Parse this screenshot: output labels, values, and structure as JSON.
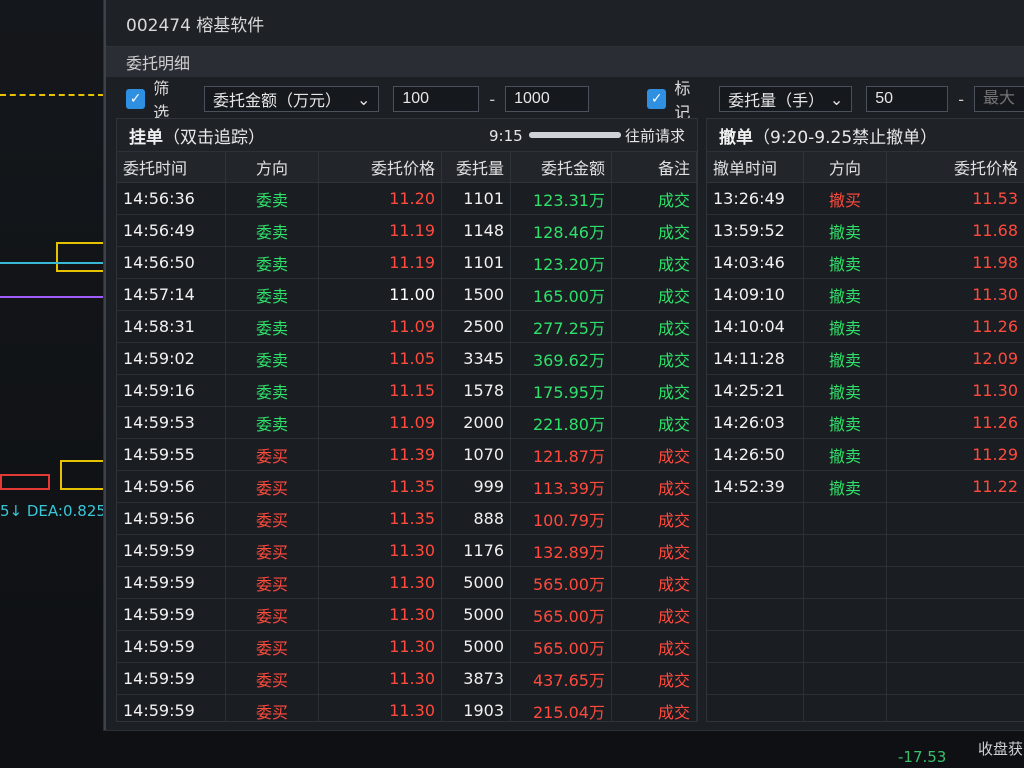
{
  "window": {
    "title": "002474 榕基软件",
    "subtitle": "委托明细"
  },
  "filter": {
    "checkbox1_label": "筛选",
    "amount_select": "委托金额（万元）",
    "amount_min": "100",
    "amount_max": "1000",
    "checkbox2_label": "标记",
    "qty_select": "委托量（手）",
    "qty_min": "50",
    "qty_max_placeholder": "最大"
  },
  "left_panel": {
    "title": "挂单",
    "title_hint": "（双击追踪）",
    "time": "9:15",
    "progress_pct": 100,
    "request_btn": "往前请求",
    "columns": [
      "委托时间",
      "方向",
      "委托价格",
      "委托量",
      "委托金额",
      "备注"
    ],
    "rows": [
      {
        "time": "14:56:36",
        "dir": "委卖",
        "side": "sell",
        "price": "11.20",
        "price_color": "red",
        "vol": "1101",
        "amt": "123.31万",
        "remark": "成交"
      },
      {
        "time": "14:56:49",
        "dir": "委卖",
        "side": "sell",
        "price": "11.19",
        "price_color": "red",
        "vol": "1148",
        "amt": "128.46万",
        "remark": "成交"
      },
      {
        "time": "14:56:50",
        "dir": "委卖",
        "side": "sell",
        "price": "11.19",
        "price_color": "red",
        "vol": "1101",
        "amt": "123.20万",
        "remark": "成交"
      },
      {
        "time": "14:57:14",
        "dir": "委卖",
        "side": "sell",
        "price": "11.00",
        "price_color": "white",
        "vol": "1500",
        "amt": "165.00万",
        "remark": "成交"
      },
      {
        "time": "14:58:31",
        "dir": "委卖",
        "side": "sell",
        "price": "11.09",
        "price_color": "red",
        "vol": "2500",
        "amt": "277.25万",
        "remark": "成交"
      },
      {
        "time": "14:59:02",
        "dir": "委卖",
        "side": "sell",
        "price": "11.05",
        "price_color": "red",
        "vol": "3345",
        "amt": "369.62万",
        "remark": "成交"
      },
      {
        "time": "14:59:16",
        "dir": "委卖",
        "side": "sell",
        "price": "11.15",
        "price_color": "red",
        "vol": "1578",
        "amt": "175.95万",
        "remark": "成交"
      },
      {
        "time": "14:59:53",
        "dir": "委卖",
        "side": "sell",
        "price": "11.09",
        "price_color": "red",
        "vol": "2000",
        "amt": "221.80万",
        "remark": "成交"
      },
      {
        "time": "14:59:55",
        "dir": "委买",
        "side": "buy",
        "price": "11.39",
        "price_color": "red",
        "vol": "1070",
        "amt": "121.87万",
        "remark": "成交"
      },
      {
        "time": "14:59:56",
        "dir": "委买",
        "side": "buy",
        "price": "11.35",
        "price_color": "red",
        "vol": "999",
        "amt": "113.39万",
        "remark": "成交"
      },
      {
        "time": "14:59:56",
        "dir": "委买",
        "side": "buy",
        "price": "11.35",
        "price_color": "red",
        "vol": "888",
        "amt": "100.79万",
        "remark": "成交"
      },
      {
        "time": "14:59:59",
        "dir": "委买",
        "side": "buy",
        "price": "11.30",
        "price_color": "red",
        "vol": "1176",
        "amt": "132.89万",
        "remark": "成交"
      },
      {
        "time": "14:59:59",
        "dir": "委买",
        "side": "buy",
        "price": "11.30",
        "price_color": "red",
        "vol": "5000",
        "amt": "565.00万",
        "remark": "成交"
      },
      {
        "time": "14:59:59",
        "dir": "委买",
        "side": "buy",
        "price": "11.30",
        "price_color": "red",
        "vol": "5000",
        "amt": "565.00万",
        "remark": "成交"
      },
      {
        "time": "14:59:59",
        "dir": "委买",
        "side": "buy",
        "price": "11.30",
        "price_color": "red",
        "vol": "5000",
        "amt": "565.00万",
        "remark": "成交"
      },
      {
        "time": "14:59:59",
        "dir": "委买",
        "side": "buy",
        "price": "11.30",
        "price_color": "red",
        "vol": "3873",
        "amt": "437.65万",
        "remark": "成交"
      },
      {
        "time": "14:59:59",
        "dir": "委买",
        "side": "buy",
        "price": "11.30",
        "price_color": "red",
        "vol": "1903",
        "amt": "215.04万",
        "remark": "成交"
      }
    ]
  },
  "right_panel": {
    "title": "撤单",
    "title_hint": "（9:20-9.25禁止撤单）",
    "columns": [
      "撤单时间",
      "方向",
      "委托价格"
    ],
    "rows": [
      {
        "time": "13:26:49",
        "dir": "撤买",
        "side": "buy",
        "price": "11.53"
      },
      {
        "time": "13:59:52",
        "dir": "撤卖",
        "side": "sell",
        "price": "11.68"
      },
      {
        "time": "14:03:46",
        "dir": "撤卖",
        "side": "sell",
        "price": "11.98"
      },
      {
        "time": "14:09:10",
        "dir": "撤卖",
        "side": "sell",
        "price": "11.30"
      },
      {
        "time": "14:10:04",
        "dir": "撤卖",
        "side": "sell",
        "price": "11.26"
      },
      {
        "time": "14:11:28",
        "dir": "撤卖",
        "side": "sell",
        "price": "12.09"
      },
      {
        "time": "14:25:21",
        "dir": "撤卖",
        "side": "sell",
        "price": "11.30"
      },
      {
        "time": "14:26:03",
        "dir": "撤卖",
        "side": "sell",
        "price": "11.26"
      },
      {
        "time": "14:26:50",
        "dir": "撤卖",
        "side": "sell",
        "price": "11.29"
      },
      {
        "time": "14:52:39",
        "dir": "撤卖",
        "side": "sell",
        "price": "11.22"
      }
    ]
  },
  "background": {
    "dea_text": "5↓  DEA:0.825",
    "bottom_value": "-17.53",
    "bottom_label": "收盘获"
  }
}
